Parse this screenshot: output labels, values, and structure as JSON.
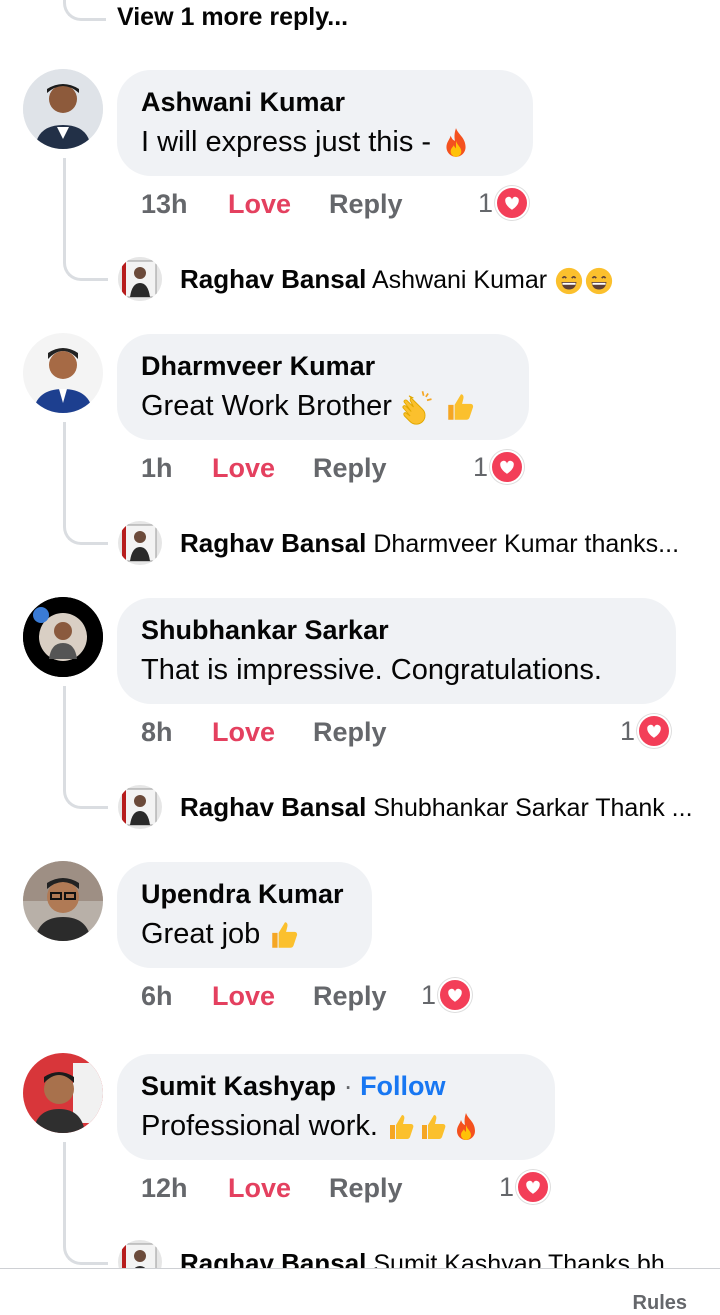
{
  "thread": {
    "view_more_label": "View 1 more reply...",
    "love_label": "Love",
    "reply_label": "Reply"
  },
  "comments": [
    {
      "author": "Ashwani Kumar",
      "text": "I will express just this -",
      "emojis": [
        "fire-emoji"
      ],
      "time": "13h",
      "reactions": "1",
      "reply": {
        "author": "Raghav Bansal",
        "text": "Ashwani Kumar",
        "emojis": [
          "grin-emoji",
          "grin-emoji"
        ]
      }
    },
    {
      "author": "Dharmveer Kumar",
      "text": "Great Work Brother",
      "emojis": [
        "clap-emoji",
        "thumbs-up-emoji"
      ],
      "time": "1h",
      "reactions": "1",
      "reply": {
        "author": "Raghav Bansal",
        "text": "Dharmveer Kumar thanks...",
        "emojis": []
      }
    },
    {
      "author": "Shubhankar Sarkar",
      "text": "That is impressive. Congratulations.",
      "emojis": [],
      "time": "8h",
      "reactions": "1",
      "reply": {
        "author": "Raghav Bansal",
        "text": "Shubhankar Sarkar Thank ...",
        "emojis": []
      }
    },
    {
      "author": "Upendra Kumar",
      "text": "Great job",
      "emojis": [
        "thumbs-up-emoji"
      ],
      "time": "6h",
      "reactions": "1"
    },
    {
      "author": "Sumit Kashyap",
      "follow_label": "Follow",
      "text": "Professional work.",
      "emojis": [
        "thumbs-up-emoji",
        "thumbs-up-emoji",
        "fire-emoji"
      ],
      "time": "12h",
      "reactions": "1",
      "reply": {
        "author": "Raghav Bansal",
        "text": "Sumit Kashyap Thanks bh",
        "emojis": []
      }
    }
  ],
  "footer": {
    "rules_label": "Rules"
  },
  "colors": {
    "bubble": "#f0f2f5",
    "love": "#e4405f",
    "meta": "#65676b",
    "follow": "#1877f2",
    "heart": "#f33e58"
  }
}
